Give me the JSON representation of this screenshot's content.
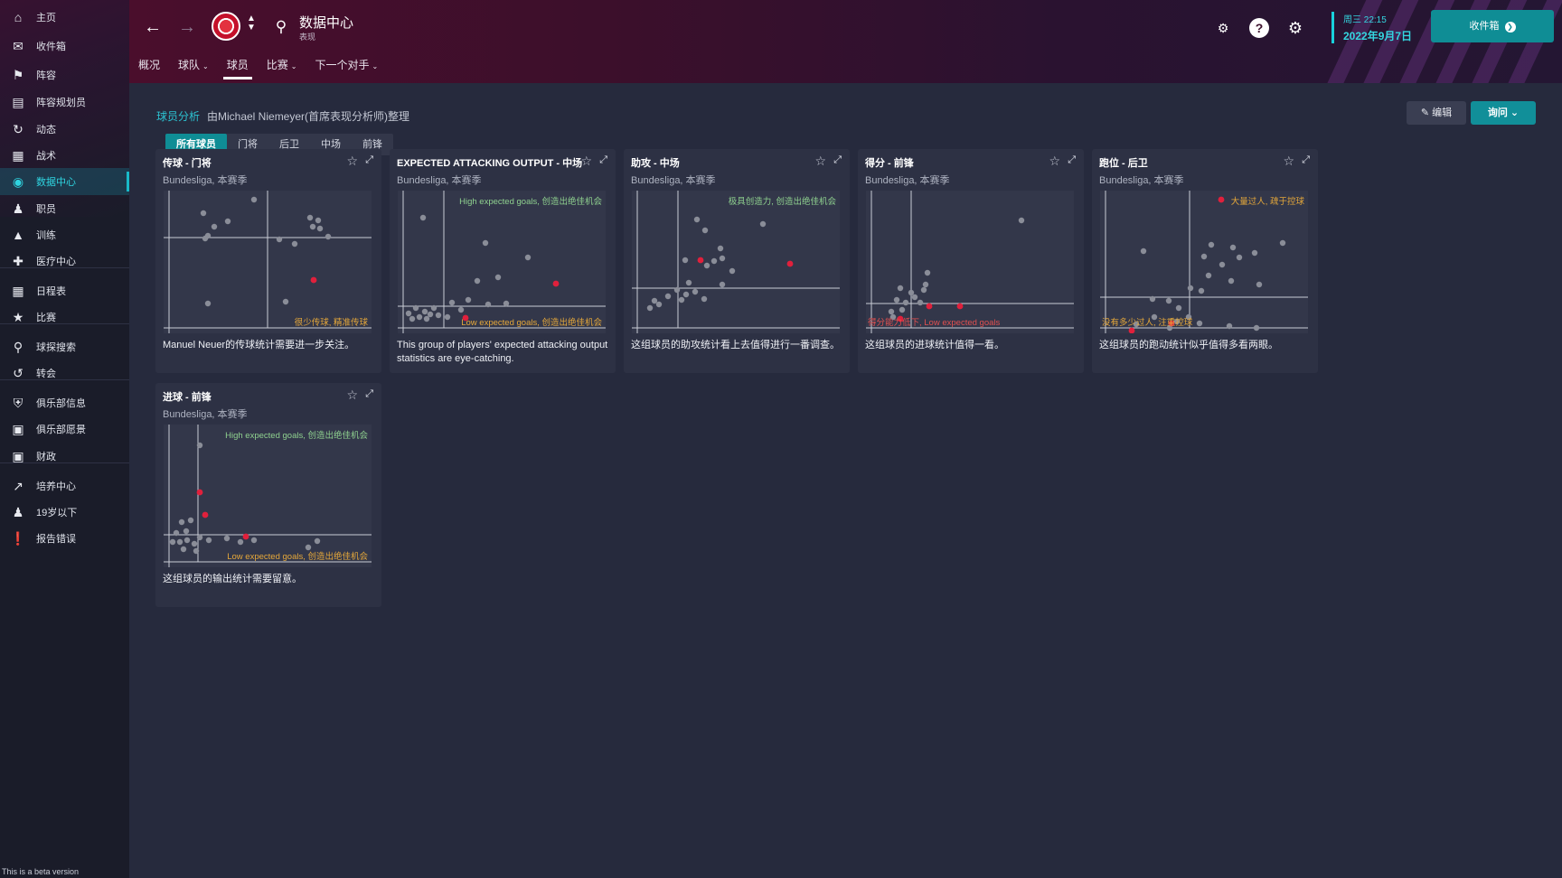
{
  "sidebar": {
    "items": [
      {
        "label": "主页",
        "icon": "home-icon"
      },
      {
        "label": "收件箱",
        "icon": "inbox-icon"
      },
      {
        "label": "阵容",
        "icon": "squad-icon"
      },
      {
        "label": "阵容规划员",
        "icon": "clipboard-icon"
      },
      {
        "label": "动态",
        "icon": "dynamics-icon"
      },
      {
        "label": "战术",
        "icon": "tactics-icon"
      },
      {
        "label": "数据中心",
        "icon": "data-hub-icon",
        "active": true
      },
      {
        "label": "职员",
        "icon": "staff-icon"
      },
      {
        "label": "训练",
        "icon": "training-icon"
      },
      {
        "label": "医疗中心",
        "icon": "medical-icon"
      },
      {
        "label": "日程表",
        "icon": "calendar-icon"
      },
      {
        "label": "比赛",
        "icon": "trophy-icon"
      },
      {
        "label": "球探搜索",
        "icon": "scouting-icon"
      },
      {
        "label": "转会",
        "icon": "transfer-icon"
      },
      {
        "label": "俱乐部信息",
        "icon": "shield-icon"
      },
      {
        "label": "俱乐部愿景",
        "icon": "vision-icon"
      },
      {
        "label": "财政",
        "icon": "finance-icon"
      },
      {
        "label": "培养中心",
        "icon": "development-icon"
      },
      {
        "label": "19岁以下",
        "icon": "youth-icon"
      },
      {
        "label": "报告错误",
        "icon": "bug-report-icon"
      }
    ],
    "beta_note": "This is a beta version"
  },
  "header": {
    "title": "数据中心",
    "subtitle": "表现",
    "tabs": [
      {
        "label": "概况",
        "dropdown": false
      },
      {
        "label": "球队",
        "dropdown": true
      },
      {
        "label": "球员",
        "dropdown": false,
        "active": true
      },
      {
        "label": "比赛",
        "dropdown": true
      },
      {
        "label": "下一个对手",
        "dropdown": true
      }
    ],
    "date_day": "周三 22:15",
    "date_full": "2022年9月7日",
    "inbox_label": "收件箱"
  },
  "content": {
    "section_title": "球员分析",
    "section_sub": "由Michael Niemeyer(首席表现分析师)整理",
    "edit_label": "编辑",
    "ask_label": "询问",
    "filters": [
      "所有球员",
      "门将",
      "后卫",
      "中场",
      "前锋"
    ],
    "cards": [
      {
        "title": "传球 - 门将",
        "league": "Bundesliga, 本赛季",
        "quadrant_top": "",
        "quadrant_bottom": "很少传球, 精准传球",
        "desc": "Manuel Neuer的传球统计需要进一步关注。"
      },
      {
        "title": "EXPECTED ATTACKING OUTPUT - 中场",
        "league": "Bundesliga, 本赛季",
        "quadrant_top": "High expected goals, 创造出绝佳机会",
        "quadrant_bottom": "Low expected goals, 创造出绝佳机会",
        "desc": "This group of players' expected attacking output statistics are eye-catching."
      },
      {
        "title": "助攻 - 中场",
        "league": "Bundesliga, 本赛季",
        "quadrant_top": "极具创造力, 创造出绝佳机会",
        "quadrant_bottom": "",
        "desc": "这组球员的助攻统计看上去值得进行一番调查。"
      },
      {
        "title": "得分 - 前锋",
        "league": "Bundesliga, 本赛季",
        "quadrant_top": "",
        "quadrant_bottom": "得分能力低下, Low expected goals",
        "desc": "这组球员的进球统计值得一看。"
      },
      {
        "title": "跑位 - 后卫",
        "league": "Bundesliga, 本赛季",
        "quadrant_top": "大量过人, 疏于控球",
        "quadrant_bottom": "没有多少过人, 注重控球",
        "desc": "这组球员的跑动统计似乎值得多看两眼。"
      },
      {
        "title": "进球 - 前锋",
        "league": "Bundesliga, 本赛季",
        "quadrant_top": "High expected goals, 创造出绝佳机会",
        "quadrant_bottom": "Low expected goals, 创造出绝佳机会",
        "desc": "这组球员的输出统计需要留意。"
      }
    ]
  },
  "colors": {
    "accent": "#19b9c8",
    "highlight_point": "#e0203c",
    "neutral_point": "#8a8d98",
    "top_quadrant_label": "#8fd18f",
    "bottom_quadrant_label": "#e6a83a"
  }
}
